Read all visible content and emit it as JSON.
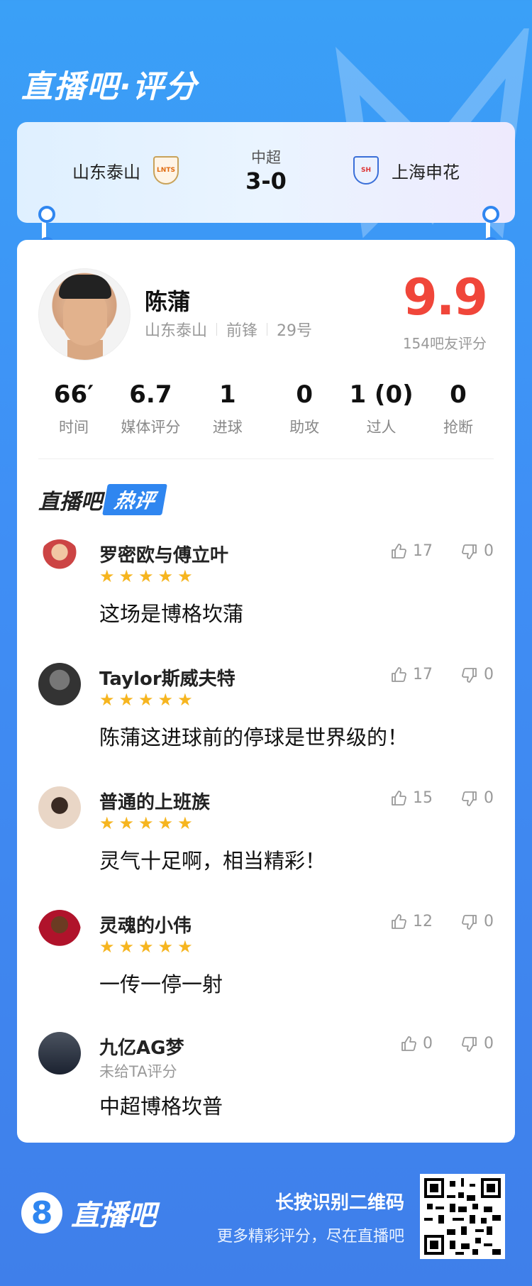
{
  "brand": {
    "title": "直播吧·评分"
  },
  "match": {
    "league": "中超",
    "score": "3-0",
    "home": {
      "name": "山东泰山",
      "crest_text": "LNTS"
    },
    "away": {
      "name": "上海申花",
      "crest_text": "SH"
    }
  },
  "player": {
    "name": "陈蒲",
    "team": "山东泰山",
    "position": "前锋",
    "number": "29号",
    "rating": "9.9",
    "rating_count": "154吧友评分"
  },
  "stats": [
    {
      "value": "66′",
      "label": "时间"
    },
    {
      "value": "6.7",
      "label": "媒体评分"
    },
    {
      "value": "1",
      "label": "进球"
    },
    {
      "value": "0",
      "label": "助攻"
    },
    {
      "value": "1 (0)",
      "label": "过人"
    },
    {
      "value": "0",
      "label": "抢断"
    }
  ],
  "hot": {
    "title": "直播吧",
    "tag": "热评"
  },
  "comments": [
    {
      "user": "罗密欧与傅立叶",
      "stars": "★★★★★",
      "text": "这场是博格坎蒲",
      "likes": "17",
      "dislikes": "0"
    },
    {
      "user": "Taylor斯威夫特",
      "stars": "★★★★★",
      "text": "陈蒲这进球前的停球是世界级的！",
      "likes": "17",
      "dislikes": "0"
    },
    {
      "user": "普通的上班族",
      "stars": "★★★★★",
      "text": "灵气十足啊，相当精彩！",
      "likes": "15",
      "dislikes": "0"
    },
    {
      "user": "灵魂的小伟",
      "stars": "★★★★★",
      "text": "一传一停一射",
      "likes": "12",
      "dislikes": "0"
    },
    {
      "user": "九亿AG梦",
      "unrated": "未给TA评分",
      "text": "中超博格坎普",
      "likes": "0",
      "dislikes": "0"
    }
  ],
  "footer": {
    "logo_digit": "8",
    "brand": "直播吧",
    "line1": "长按识别二维码",
    "line2": "更多精彩评分，尽在直播吧"
  },
  "colors": {
    "accent": "#2f86f0",
    "rating": "#f0463a",
    "star": "#f6b51f"
  }
}
